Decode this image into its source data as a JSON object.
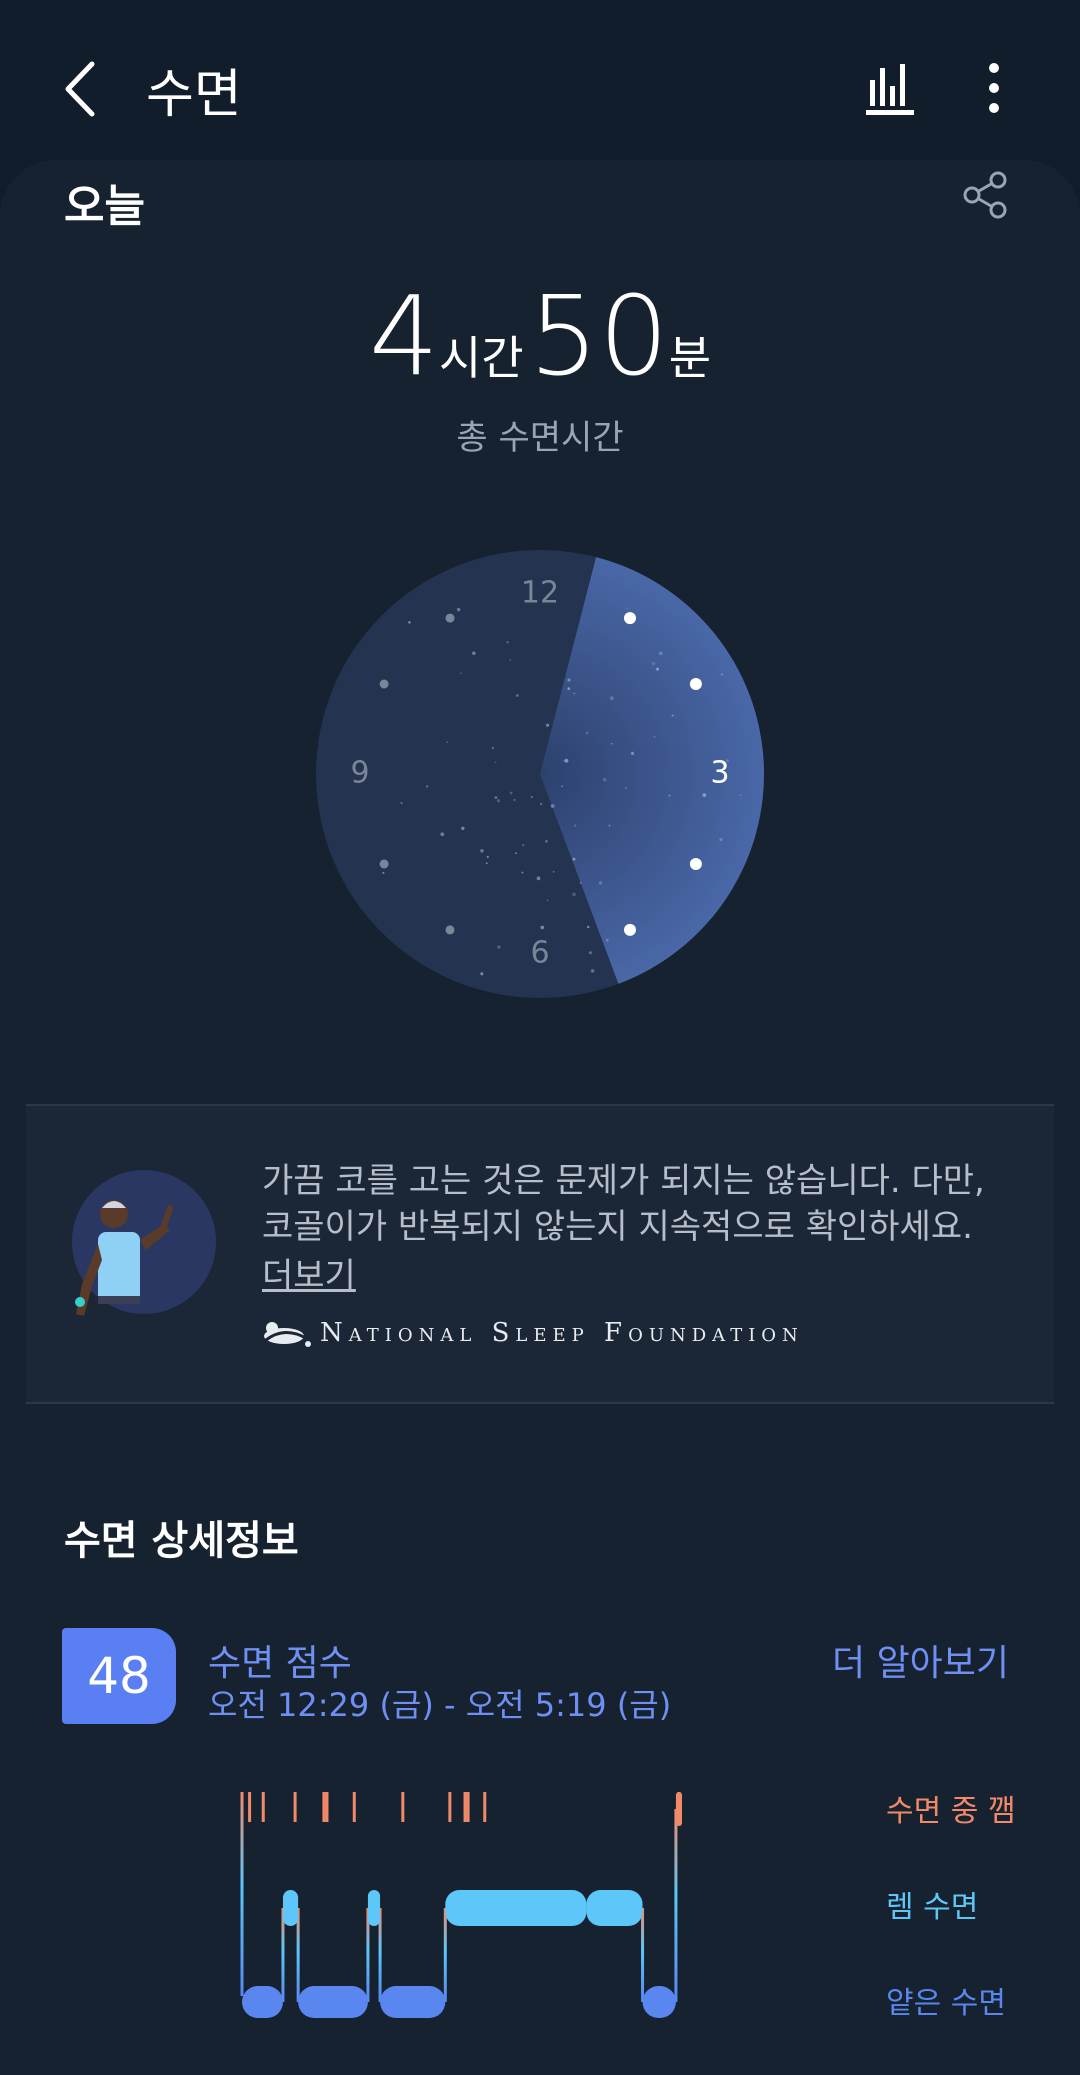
{
  "header": {
    "title": "수면",
    "back_icon": "chevron-left-icon",
    "stats_icon": "bar-chart-icon",
    "more_icon": "more-vert-icon"
  },
  "today": {
    "label": "오늘",
    "share_icon": "share-icon",
    "hours": "4",
    "hours_unit": "시간",
    "minutes": "50",
    "minutes_unit": "분",
    "caption": "총 수면시간"
  },
  "clock": {
    "labels": {
      "twelve": "12",
      "three": "3",
      "six": "6",
      "nine": "9"
    },
    "sleep_start": "12:29",
    "sleep_end": "5:19",
    "face_color": "#233350",
    "sleep_color": "#3a558e"
  },
  "tip": {
    "text": "가끔 코를 고는 것은 문제가 되지는 않습니다. 다만, 코골이가 반복되지 않는지 지속적으로 확인하세요.",
    "more": "더보기",
    "source": "National Sleep Foundation"
  },
  "details": {
    "section_title": "수면 상세정보",
    "score": "48",
    "score_label": "수면 점수",
    "range": "오전 12:29 (금) - 오전 5:19 (금)",
    "learn_more": "더 알아보기"
  },
  "chart_data": {
    "type": "step",
    "start": "00:29",
    "end": "05:19",
    "stages": [
      "수면 중 깸",
      "렘 수면",
      "얕은 수면"
    ],
    "stage_colors": {
      "awake": "#f28a6a",
      "rem": "#5cc7f8",
      "light": "#5a86f0"
    },
    "segments": [
      {
        "stage": "얕은 수면",
        "start": "00:29",
        "end": "00:56"
      },
      {
        "stage": "렘 수면",
        "start": "00:56",
        "end": "01:06"
      },
      {
        "stage": "얕은 수면",
        "start": "01:06",
        "end": "01:52"
      },
      {
        "stage": "렘 수면",
        "start": "01:52",
        "end": "02:00"
      },
      {
        "stage": "얕은 수면",
        "start": "02:00",
        "end": "02:43"
      },
      {
        "stage": "렘 수면",
        "start": "02:43",
        "end": "04:16"
      },
      {
        "stage": "렘 수면",
        "start": "04:16",
        "end": "04:53"
      },
      {
        "stage": "얕은 수면",
        "start": "04:53",
        "end": "05:15"
      },
      {
        "stage": "수면 중 깸",
        "start": "05:15",
        "end": "05:19"
      }
    ],
    "awake_marks": [
      "00:29",
      "00:34",
      "00:43",
      "01:04",
      "01:23",
      "01:25",
      "01:43",
      "02:15",
      "02:46",
      "02:56",
      "02:58",
      "03:09",
      "05:17"
    ]
  }
}
